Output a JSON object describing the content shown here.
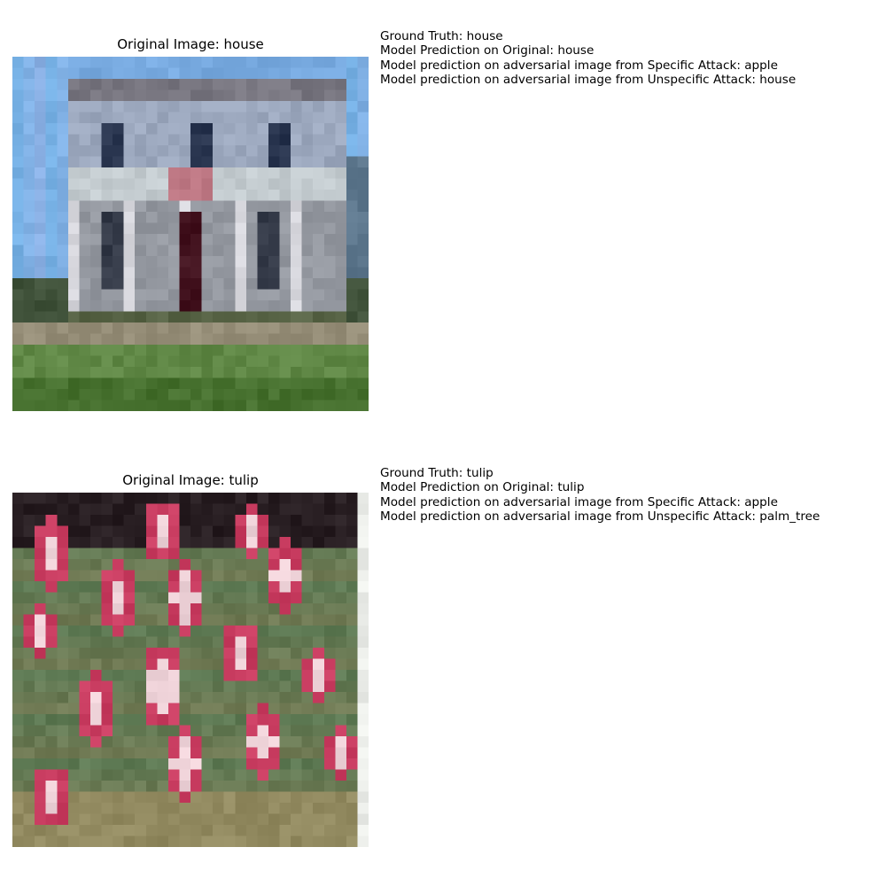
{
  "panels": [
    {
      "title": "Original Image: house",
      "image_subject": "house",
      "info": {
        "ground_truth": "Ground Truth: house",
        "pred_original": "Model Prediction on Original: house",
        "pred_specific": "Model prediction on adversarial image from Specific Attack: apple",
        "pred_unspecific": "Model prediction on adversarial image from Unspecific Attack: house"
      }
    },
    {
      "title": "Original Image: tulip",
      "image_subject": "tulip",
      "info": {
        "ground_truth": "Ground Truth: tulip",
        "pred_original": "Model Prediction on Original: tulip",
        "pred_specific": "Model prediction on adversarial image from Specific Attack: apple",
        "pred_unspecific": "Model prediction on adversarial image from Unspecific Attack: palm_tree"
      }
    }
  ]
}
